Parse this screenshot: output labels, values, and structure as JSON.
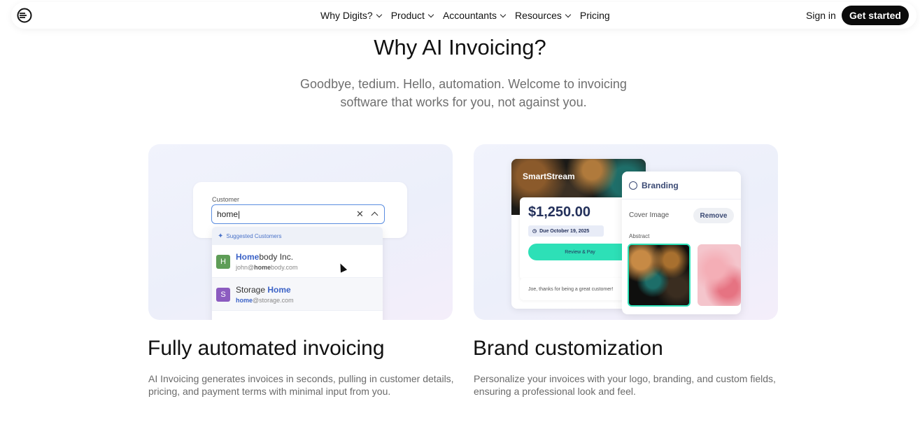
{
  "nav": {
    "links": [
      {
        "label": "Why Digits?",
        "has_dropdown": true
      },
      {
        "label": "Product",
        "has_dropdown": true
      },
      {
        "label": "Accountants",
        "has_dropdown": true
      },
      {
        "label": "Resources",
        "has_dropdown": true
      },
      {
        "label": "Pricing",
        "has_dropdown": false
      }
    ],
    "sign_in": "Sign in",
    "cta": "Get started"
  },
  "hero": {
    "title": "Why AI Invoicing?",
    "subtitle": "Goodbye, tedium. Hello, automation. Welcome to invoicing software that works for you, not against you."
  },
  "cards": {
    "left": {
      "customer_label": "Customer",
      "input_value": "home|",
      "suggested_header": "Suggested Customers",
      "items": [
        {
          "initial": "H",
          "color": "#5e9d57",
          "name_hl": "Home",
          "name_rest": "body Inc.",
          "email_pre": "john@",
          "email_hl": "home",
          "email_post": "body.com"
        },
        {
          "initial": "S",
          "color": "#8c5cc0",
          "name_pre": "Storage ",
          "name_hl": "Home",
          "email_hl": "home",
          "email_post": "@storage.com"
        }
      ]
    },
    "right": {
      "brand": "SmartStream",
      "amount": "$1,250.00",
      "due": "Due October 19, 2025",
      "pay": "Review & Pay",
      "note": "Joe, thanks for being a great customer!",
      "branding_title": "Branding",
      "cover_image": "Cover Image",
      "remove": "Remove",
      "abstract": "Abstract"
    }
  },
  "features": [
    {
      "title": "Fully automated invoicing",
      "desc": "AI Invoicing generates invoices in seconds, pulling in customer details, pricing, and payment terms with minimal input from you."
    },
    {
      "title": "Brand customization",
      "desc": "Personalize your invoices with your logo, branding, and custom fields, ensuring a professional look and feel."
    }
  ],
  "colors": {
    "accent": "#3c63c7",
    "mint": "#2de0b7",
    "dark": "#0b0b0b"
  }
}
